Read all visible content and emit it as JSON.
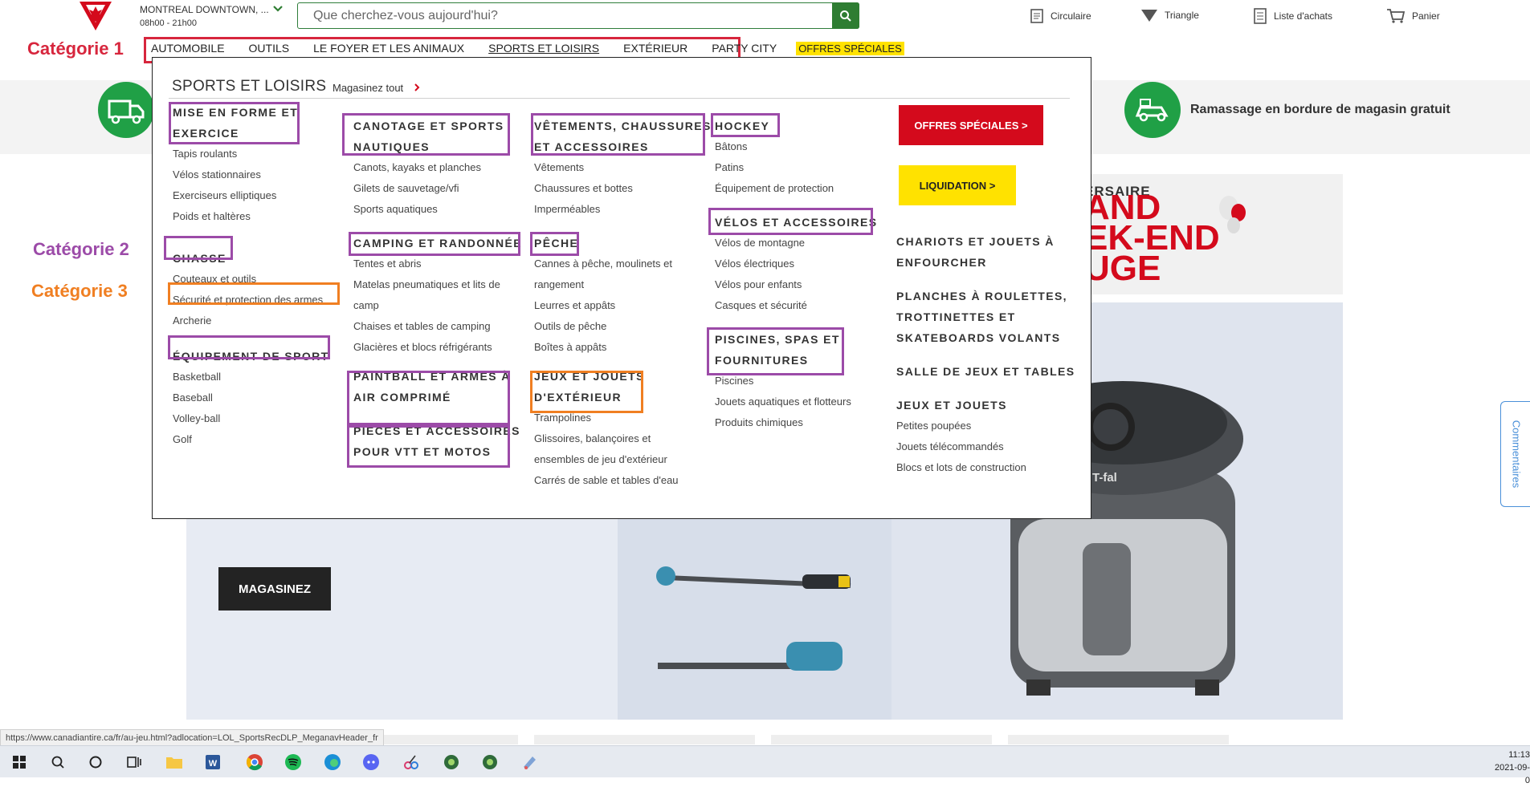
{
  "header": {
    "store_name": "MONTREAL DOWNTOWN, ...",
    "store_hours": "08h00 - 21h00",
    "search_placeholder": "Que cherchez-vous aujourd'hui?",
    "utilities": [
      {
        "label": "Circulaire",
        "icon": "flyer-icon"
      },
      {
        "label": "Triangle",
        "icon": "triangle-icon"
      },
      {
        "label": "Liste d'achats",
        "icon": "list-icon"
      },
      {
        "label": "Panier",
        "icon": "cart-icon"
      }
    ]
  },
  "nav": {
    "items": [
      "AUTOMOBILE",
      "OUTILS",
      "LE FOYER ET LES ANIMAUX",
      "SPORTS ET LOISIRS",
      "EXTÉRIEUR",
      "PARTY CITY"
    ],
    "special": "OFFRES SPÉCIALES"
  },
  "annotations": {
    "cat1": "Catégorie 1",
    "cat2": "Catégorie 2",
    "cat3": "Catégorie 3",
    "colors": {
      "cat1": "#d7263d",
      "cat2": "#9c4ba8",
      "cat3": "#f07f22"
    }
  },
  "mega_menu": {
    "title": "SPORTS ET LOISIRS",
    "shop_all": "Magasinez tout",
    "col1": {
      "g1_head": [
        "MISE EN FORME ET",
        "EXERCICE"
      ],
      "g1_items": [
        "Tapis roulants",
        "Vélos stationnaires",
        "Exerciseurs elliptiques",
        "Poids et haltères"
      ],
      "g2_head": "CHASSE",
      "g2_items": [
        "Couteaux et outils",
        "Sécurité et protection des armes",
        "Archerie"
      ],
      "g3_head": "ÉQUIPEMENT DE SPORT",
      "g3_items": [
        "Basketball",
        "Baseball",
        "Volley-ball",
        "Golf"
      ]
    },
    "col2": {
      "g1_head": [
        "CANOTAGE ET SPORTS",
        "NAUTIQUES"
      ],
      "g1_items": [
        "Canots, kayaks et planches",
        "Gilets de sauvetage/vfi",
        "Sports aquatiques"
      ],
      "g2_head": "CAMPING ET RANDONNÉE",
      "g2_items": [
        "Tentes et abris",
        "Matelas pneumatiques et lits de",
        "camp",
        "Chaises et tables de camping",
        "Glacières et blocs réfrigérants"
      ],
      "g3_head": [
        "PAINTBALL ET ARMES À",
        "AIR COMPRIMÉ"
      ],
      "g4_head": [
        "PIÈCES ET ACCESSOIRES",
        "POUR VTT ET MOTOS"
      ]
    },
    "col3": {
      "g1_head": [
        "VÊTEMENTS, CHAUSSURES",
        "ET ACCESSOIRES"
      ],
      "g1_items": [
        "Vêtements",
        "Chaussures et bottes",
        "Imperméables"
      ],
      "g2_head": "PÊCHE",
      "g2_items": [
        "Cannes à pêche, moulinets et",
        "rangement",
        "Leurres et appâts",
        "Outils de pêche",
        "Boîtes à appâts"
      ],
      "g3_head": [
        "JEUX ET JOUETS",
        "D'EXTÉRIEUR"
      ],
      "g3_items": [
        "Trampolines",
        "Glissoires, balançoires et",
        "ensembles de jeu d'extérieur",
        "Carrés de sable et tables d'eau"
      ]
    },
    "col4": {
      "g1_head": "HOCKEY",
      "g1_items": [
        "Bâtons",
        "Patins",
        "Équipement de protection"
      ],
      "g2_head": "VÉLOS ET ACCESSOIRES",
      "g2_items": [
        "Vélos de montagne",
        "Vélos électriques",
        "Vélos pour enfants",
        "Casques et sécurité"
      ],
      "g3_head": [
        "PISCINES, SPAS ET",
        "FOURNITURES"
      ],
      "g3_items": [
        "Piscines",
        "Jouets aquatiques et flotteurs",
        "Produits chimiques"
      ]
    },
    "col5": {
      "btn_special": "OFFRES SPÉCIALES >",
      "btn_liquidation": "LIQUIDATION >",
      "g1_head": [
        "CHARIOTS ET JOUETS À",
        "ENFOURCHER"
      ],
      "g2_head": [
        "PLANCHES À ROULETTES,",
        "TROTTINETTES ET",
        "SKATEBOARDS VOLANTS"
      ],
      "g3_head": "SALLE DE JEUX ET TABLES",
      "g4_head": "JEUX ET JOUETS",
      "g4_items": [
        "Petites poupées",
        "Jouets télécommandés",
        "Blocs et lots de construction"
      ]
    }
  },
  "page": {
    "pickup_text": "Ramassage en bordure de magasin gratuit",
    "promo_lines": [
      "ERSAIRE",
      "AND",
      "EK-END",
      "UGE"
    ],
    "shop_button": "MAGASINEZ",
    "product_brand": "T-fal",
    "feedback": "Commentaires"
  },
  "status": {
    "url": "https://www.canadiantire.ca/fr/au-jeu.html?adlocation=LOL_SportsRecDLP_MeganavHeader_fr"
  },
  "taskbar": {
    "time": "11:13",
    "date": "2021-09-0"
  }
}
